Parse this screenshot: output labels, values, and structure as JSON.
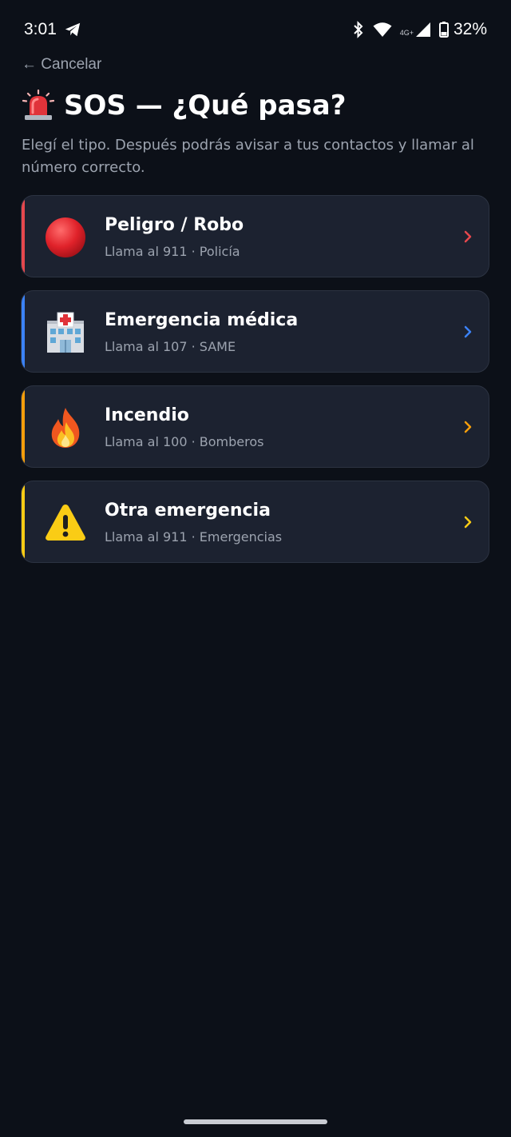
{
  "status_bar": {
    "time": "3:01",
    "network_badge": "4G+",
    "battery": "32%"
  },
  "header": {
    "cancel_label": "← Cancelar",
    "title": "SOS — ¿Qué pasa?",
    "subtitle": "Elegí el tipo. Después podrás avisar a tus contactos y llamar al número correcto."
  },
  "options": [
    {
      "title": "Peligro / Robo",
      "subtitle": "Llama al 911 · Policía",
      "icon": "red-circle-icon",
      "accent": "#e5484d"
    },
    {
      "title": "Emergencia médica",
      "subtitle": "Llama al 107 · SAME",
      "icon": "hospital-icon",
      "accent": "#3b82f6"
    },
    {
      "title": "Incendio",
      "subtitle": "Llama al 100 · Bomberos",
      "icon": "fire-icon",
      "accent": "#f59e0b"
    },
    {
      "title": "Otra emergencia",
      "subtitle": "Llama al 911 · Emergencias",
      "icon": "warning-icon",
      "accent": "#facc15"
    }
  ]
}
